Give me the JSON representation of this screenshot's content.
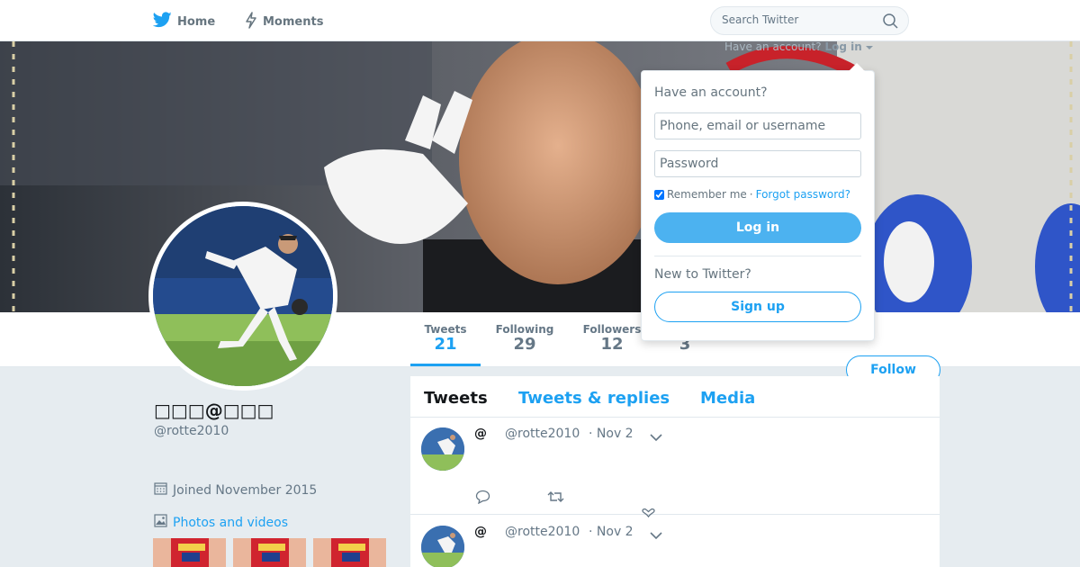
{
  "topnav": {
    "home_label": "Home",
    "moments_label": "Moments",
    "search_placeholder": "Search Twitter"
  },
  "login_prompt": {
    "question": "Have an account?",
    "login_label": "Log in"
  },
  "login_dropdown": {
    "heading": "Have an account?",
    "username_placeholder": "Phone, email or username",
    "password_placeholder": "Password",
    "remember_me": "Remember me",
    "separator": "·",
    "forgot_password": "Forgot password?",
    "login_button": "Log in",
    "new_heading": "New to Twitter?",
    "signup_button": "Sign up"
  },
  "profile_nav": {
    "stats": [
      {
        "label": "Tweets",
        "value": "21"
      },
      {
        "label": "Following",
        "value": "29"
      },
      {
        "label": "Followers",
        "value": "12"
      },
      {
        "label": "",
        "value": "3"
      }
    ],
    "follow_button": "Follow"
  },
  "profile": {
    "display_name": "□□□@□□□",
    "handle": "@rotte2010",
    "joined": "Joined November 2015",
    "photos_link": "Photos and videos"
  },
  "timeline": {
    "tabs": [
      "Tweets",
      "Tweets & replies",
      "Media"
    ],
    "tweets": [
      {
        "name": "@",
        "handle": "@rotte2010",
        "date": "· Nov 2"
      },
      {
        "name": "@",
        "handle": "@rotte2010",
        "date": "· Nov 2"
      }
    ]
  },
  "colors": {
    "accent": "#1da1f2",
    "background": "#e6ecf0"
  }
}
